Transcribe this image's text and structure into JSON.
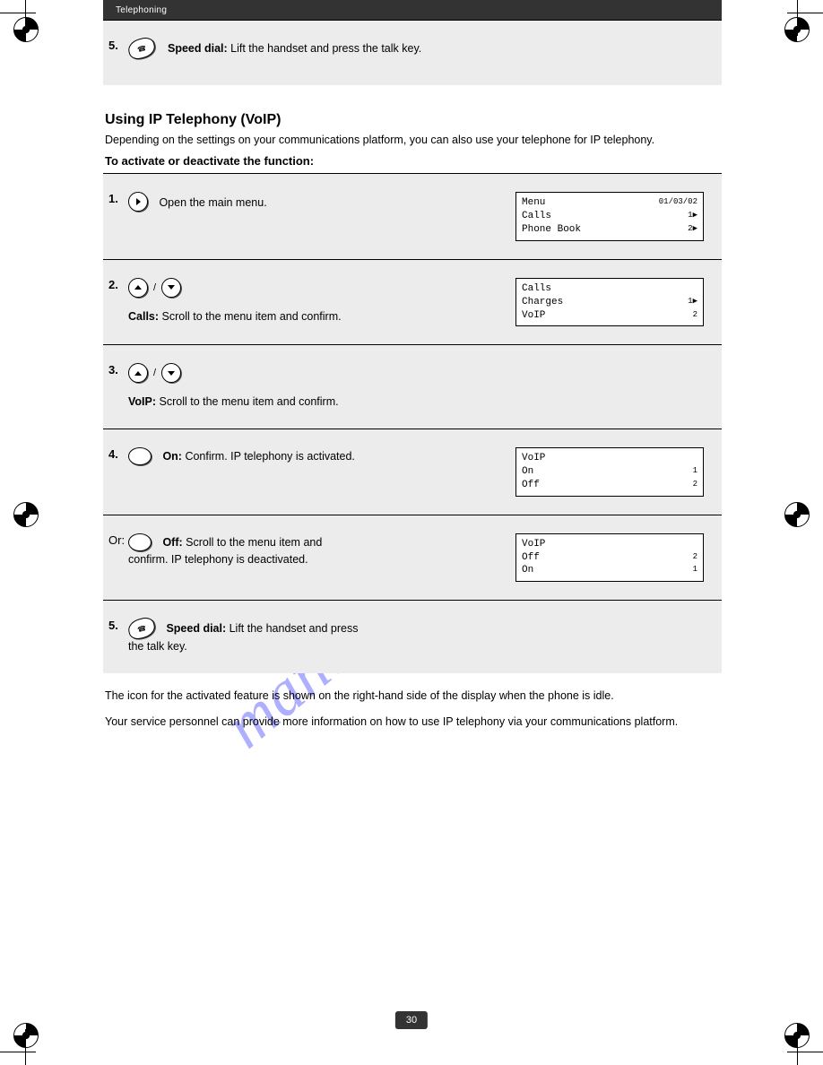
{
  "header": {
    "title": "Telephoning"
  },
  "watermark": "manualshive.com",
  "top_step": {
    "num": "5.",
    "lead": "Speed dial:",
    "text": " Lift the handset and press the talk key."
  },
  "section": {
    "title": "Using IP Telephony (VoIP)",
    "intro": "Depending on the settings on your communications platform, you can also use your telephone for IP telephony.",
    "subhead": "To activate or deactivate the function:"
  },
  "steps": [
    {
      "num": "1.",
      "icons": [
        "right"
      ],
      "text": "Open the main menu.",
      "display": {
        "lines": [
          {
            "l": "Menu",
            "r": "01/03/02"
          },
          {
            "l": "Calls",
            "r": "1▶"
          },
          {
            "l": "Phone Book",
            "r": "2▶"
          }
        ]
      }
    },
    {
      "num": "2.",
      "icons": [
        "up",
        "down"
      ],
      "lead": "Calls: ",
      "text": "Scroll to the menu item and confirm.",
      "display": {
        "lines": [
          {
            "l": "Calls",
            "r": ""
          },
          {
            "l": "Charges",
            "r": "1▶"
          },
          {
            "l": "VoIP",
            "r": "2"
          }
        ]
      }
    },
    {
      "num": "3.",
      "icons": [
        "up",
        "down"
      ],
      "lead": "VoIP: ",
      "text": "Scroll to the menu item and confirm.",
      "display": null
    },
    {
      "num": "4.",
      "icons": [
        "oval"
      ],
      "lead": "On: ",
      "text": "Confirm. IP telephony is activated.",
      "display": {
        "lines": [
          {
            "l": "VoIP",
            "r": ""
          },
          {
            "l": "On",
            "r": "1"
          },
          {
            "l": "Off",
            "r": "2"
          }
        ]
      }
    },
    {
      "num": "",
      "label": "Or:",
      "icons": [
        "oval"
      ],
      "lead": "Off: ",
      "text": "Scroll to the menu item and confirm. IP telephony is deactivated.",
      "display": {
        "lines": [
          {
            "l": "VoIP",
            "r": ""
          },
          {
            "l": "Off",
            "r": "2"
          },
          {
            "l": "On",
            "r": "1"
          }
        ]
      }
    },
    {
      "num": "5.",
      "icons": [
        "bean"
      ],
      "lead": "Speed dial: ",
      "text": "Lift the handset and press the talk key.",
      "display": null
    }
  ],
  "footer": {
    "text1": "The icon for the activated feature is shown on the right-hand side of the display when the phone is idle.",
    "text2": "Your service personnel can provide more information on how to use IP telephony via your communications platform."
  },
  "page_number": "30"
}
